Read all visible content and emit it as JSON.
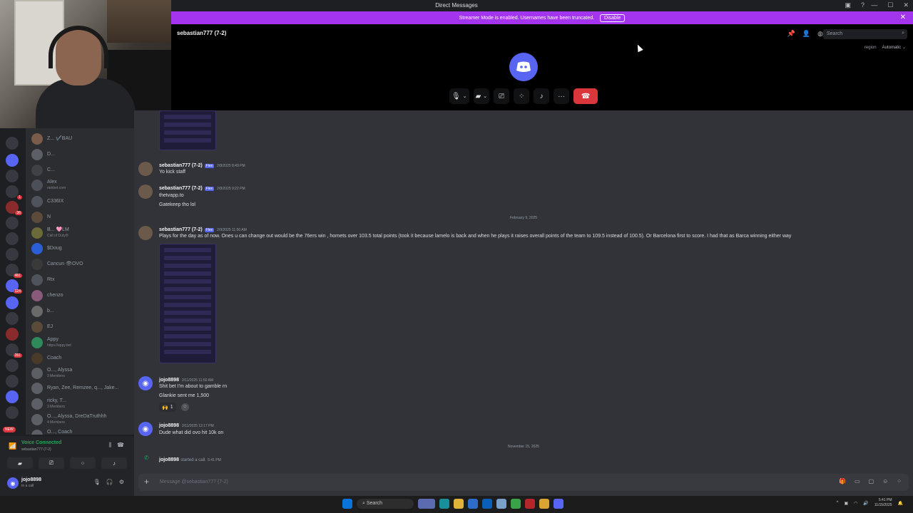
{
  "titlebar": {
    "title": "Direct Messages"
  },
  "banner": {
    "text": "Streamer Mode is enabled. Usernames have been truncated.",
    "disable": "Disable",
    "close": "✕"
  },
  "call": {
    "channel": "sebastian777 (7-2)",
    "search_placeholder": "Search",
    "region_label": "region",
    "region_value": "Automatic"
  },
  "dms": [
    {
      "name": "Z... ✔️BAU",
      "sub": ""
    },
    {
      "name": "D...",
      "sub": ""
    },
    {
      "name": "C...",
      "sub": ""
    },
    {
      "name": "Alex",
      "sub": "rainbet.com"
    },
    {
      "name": "C336IX",
      "sub": ""
    },
    {
      "name": "N",
      "sub": ""
    },
    {
      "name": "B... 🩷LM",
      "sub": "Call of Duty®"
    },
    {
      "name": "$Doug",
      "sub": ""
    },
    {
      "name": "Cancun 👁OVO",
      "sub": ""
    },
    {
      "name": "Rtx",
      "sub": ""
    },
    {
      "name": "chenzo",
      "sub": ""
    },
    {
      "name": "b...",
      "sub": ""
    },
    {
      "name": "EJ",
      "sub": ""
    },
    {
      "name": "Appy",
      "sub": "https://appy.bet"
    },
    {
      "name": "Coach",
      "sub": ""
    },
    {
      "name": "O..., Alyssa",
      "sub": "3 Members"
    },
    {
      "name": "Ryan, Zee, Remzee, q..., Jake...",
      "sub": ""
    },
    {
      "name": "ricky, T...",
      "sub": "3 Members"
    },
    {
      "name": "O..., Alyssa, DreDaTruthhh",
      "sub": "4 Members"
    },
    {
      "name": "O..., Coach",
      "sub": "3 Members"
    }
  ],
  "rail": {
    "new_badge": "NEW",
    "badges": [
      "1",
      "36",
      "461",
      "124",
      "261"
    ]
  },
  "voice": {
    "status": "Voice Connected",
    "channel": "sebastian777 (7-2)"
  },
  "user": {
    "name": "jojo8898",
    "status": "In a call"
  },
  "messages": [
    {
      "author": "sebastian777 (7-2)",
      "tag": "Flex",
      "time": "2/8/2025 8:49 PM",
      "lines": [
        "Yo kick staff"
      ]
    },
    {
      "author": "sebastian777 (7-2)",
      "tag": "Flex",
      "time": "2/8/2025 9:22 PM",
      "lines": [
        "thetvapp.to",
        "Gatekeep tho lol"
      ]
    },
    {
      "author": "sebastian777 (7-2)",
      "tag": "Flex",
      "time": "2/9/2025 11:50 AM",
      "lines": [
        "Plays for the day as of now. Ones u can change out would be the 76ers win , hornets over 103.5 total points (took it because lamelo is back and when he plays it raises overall points of the team to 109.5 instead of 100.5). Or Barcelona first to score. I had that as Barca winning either way"
      ]
    },
    {
      "author": "jojo8898",
      "tag": "",
      "time": "2/11/2025 11:50 AM",
      "lines": [
        "Shit bet I'm about to gamble rn",
        "Glankie sent me 1,500"
      ],
      "reaction": {
        "emoji": "🙌",
        "count": "1"
      }
    },
    {
      "author": "jojo8898",
      "tag": "",
      "time": "2/11/2025 12:17 PM",
      "lines": [
        "Dude what did ovo hit 10k on"
      ]
    }
  ],
  "dividers": {
    "feb": "February 9, 2025",
    "nov": "November 15, 2025"
  },
  "callnotice": {
    "author": "jojo8898",
    "text": "started a call.",
    "time": "5:41 PM"
  },
  "composer": {
    "placeholder": "Message @sebastian777 (7-2)"
  },
  "taskbar": {
    "search": "Search",
    "time": "5:41 PM",
    "date": "11/15/2025"
  }
}
